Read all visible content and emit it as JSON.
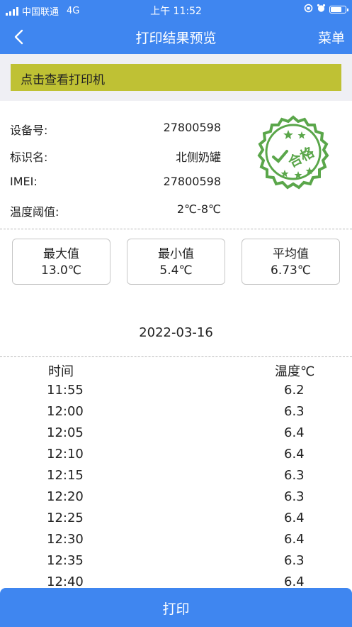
{
  "status_bar": {
    "carrier": "中国联通",
    "network": "4G",
    "time": "上午 11:52"
  },
  "nav": {
    "title": "打印结果预览",
    "menu_label": "菜单"
  },
  "printer_bar": {
    "label": "点击查看打印机"
  },
  "device_info": [
    {
      "key": "设备号:",
      "value": "27800598"
    },
    {
      "key": "标识名:",
      "value": "北侧奶罐"
    },
    {
      "key": "IMEI:",
      "value": "27800598"
    },
    {
      "key": "温度阈值:",
      "value": "2℃-8℃"
    }
  ],
  "stamp": {
    "text": "合格"
  },
  "stats": [
    {
      "label": "最大值",
      "value": "13.0℃"
    },
    {
      "label": "最小值",
      "value": "5.4℃"
    },
    {
      "label": "平均值",
      "value": "6.73℃"
    }
  ],
  "date": "2022-03-16",
  "table": {
    "headers": [
      "时间",
      "温度℃"
    ],
    "rows": [
      {
        "time": "11:55",
        "temp": "6.2"
      },
      {
        "time": "12:00",
        "temp": "6.3"
      },
      {
        "time": "12:05",
        "temp": "6.4"
      },
      {
        "time": "12:10",
        "temp": "6.4"
      },
      {
        "time": "12:15",
        "temp": "6.3"
      },
      {
        "time": "12:20",
        "temp": "6.3"
      },
      {
        "time": "12:25",
        "temp": "6.4"
      },
      {
        "time": "12:30",
        "temp": "6.4"
      },
      {
        "time": "12:35",
        "temp": "6.3"
      },
      {
        "time": "12:40",
        "temp": "6.4"
      }
    ]
  },
  "print_button": "打印",
  "colors": {
    "primary": "#3f86f0",
    "printer_bar": "#bfc134",
    "stamp": "#5aa64a"
  }
}
